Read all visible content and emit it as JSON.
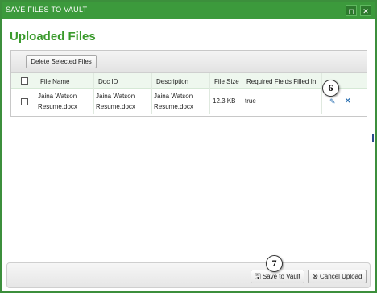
{
  "window": {
    "title": "SAVE FILES TO VAULT",
    "maximize_glyph": "◻",
    "close_glyph": "✕"
  },
  "page": {
    "heading": "Uploaded Files"
  },
  "toolbar": {
    "delete_label": "Delete Selected Files"
  },
  "table": {
    "headers": [
      "File Name",
      "Doc ID",
      "Description",
      "File Size",
      "Required Fields Filled In"
    ],
    "rows": [
      {
        "file_name": [
          "Jaina Watson",
          "Resume.docx"
        ],
        "doc_id": [
          "Jaina Watson",
          "Resume.docx"
        ],
        "description": [
          "Jaina Watson",
          "Resume.docx"
        ],
        "file_size": "12.3 KB",
        "required_filled": "true"
      }
    ]
  },
  "callouts": {
    "edit": "6",
    "save": "7"
  },
  "footer": {
    "save_label": "Save to Vault",
    "cancel_label": "Cancel Upload"
  },
  "icons": {
    "edit": "pencil-icon",
    "delete_row": "x-icon",
    "save": "floppy-disk-icon",
    "cancel": "cancel-circle-icon"
  },
  "colors": {
    "titlebar": "#3c9a3c",
    "heading": "#3a9a2c",
    "action_icon": "#2a6fb0"
  }
}
